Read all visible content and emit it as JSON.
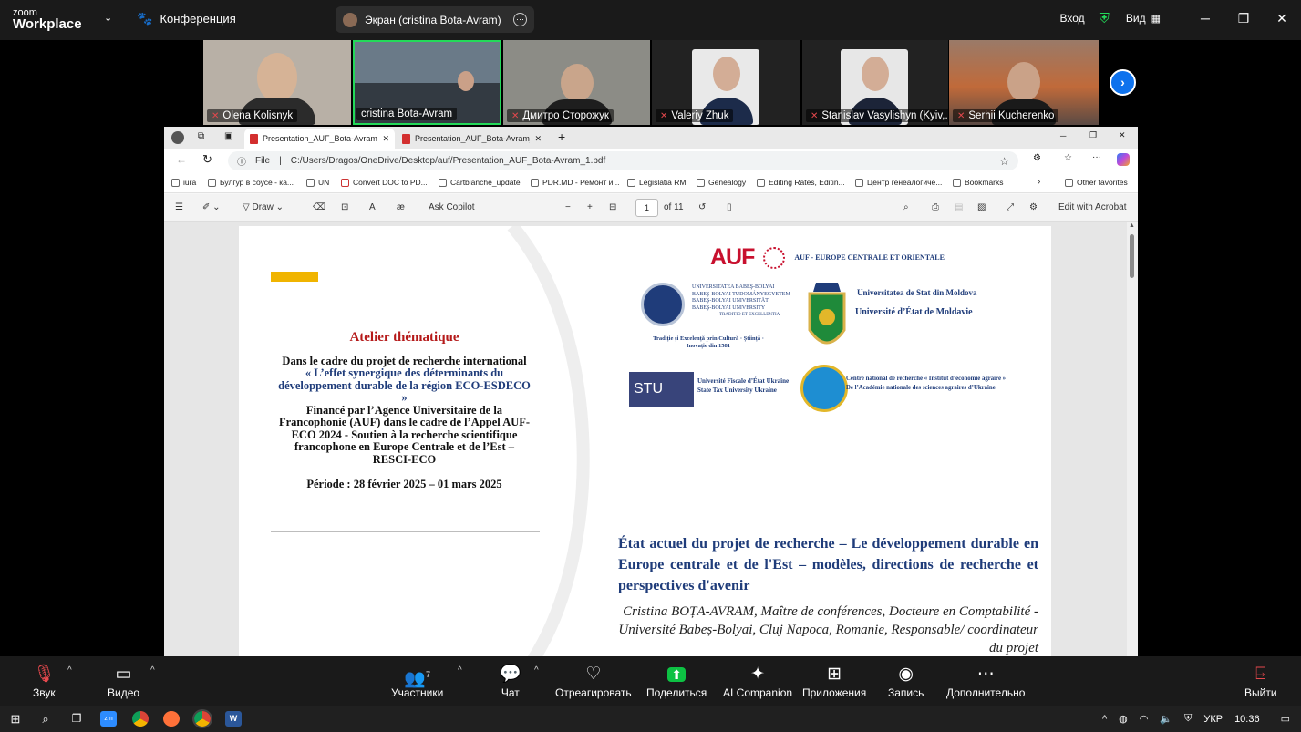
{
  "zoom": {
    "logo_line1": "zoom",
    "logo_line2": "Workplace",
    "conference_label": "Конференция",
    "screen_share_label": "Экран (cristina Bota-Avram)",
    "signin_label": "Вход",
    "view_label": "Вид",
    "participants": [
      {
        "name": "Olena Kolisnyk",
        "muted": true
      },
      {
        "name": "cristina Bota-Avram",
        "muted": false,
        "active": true
      },
      {
        "name": "Дмитро Сторожук",
        "muted": true
      },
      {
        "name": "Valeriy Zhuk",
        "muted": true
      },
      {
        "name": "Stanislav Vasylishyn (Kyiv,...",
        "muted": true
      },
      {
        "name": "Serhii Kucherenko",
        "muted": true
      }
    ],
    "controls": {
      "audio": "Звук",
      "video": "Видео",
      "participants": "Участники",
      "participants_count": "7",
      "chat": "Чат",
      "react": "Отреагировать",
      "share": "Поделиться",
      "companion": "AI Companion",
      "apps": "Приложения",
      "record": "Запись",
      "more": "Дополнительно",
      "leave": "Выйти"
    }
  },
  "browser": {
    "tabs": [
      {
        "title": "Presentation_AUF_Bota-Avram_1..."
      },
      {
        "title": "Presentation_AUF_Bota-Avram_2..."
      }
    ],
    "file_label": "File",
    "url": "C:/Users/Dragos/OneDrive/Desktop/auf/Presentation_AUF_Bota-Avram_1.pdf",
    "bookmarks": [
      "iura",
      "Булгур в соусе - ка...",
      "UN",
      "Convert DOC to PD...",
      "Cartblanche_update",
      "PDR.MD - Ремонт и...",
      "Legislatia RM",
      "Genealogy",
      "Editing Rates, Editin...",
      "Центр генеалогиче...",
      "Bookmarks"
    ],
    "other_favorites": "Other favorites",
    "pdf_toolbar": {
      "draw": "Draw",
      "ask_copilot": "Ask Copilot",
      "page_current": "1",
      "page_total": "of 11",
      "edit_acrobat": "Edit with Acrobat"
    }
  },
  "slide": {
    "atelier": "Atelier thématique",
    "intro": "Dans le cadre du projet de recherche international",
    "project_title": "« L’effet synergique des déterminants du développement durable de la région ECO-ESDECO »",
    "funding": "Financé par l’Agence Universitaire de la Francophonie (AUF) dans le cadre de l’Appel AUF-ECO 2024 - Soutien à la recherche scientifique francophone en Europe Centrale et de l’Est – RESCI-ECO",
    "periode": "Période : 28 février 2025 – 01 mars 2025",
    "auf_word": "AUF",
    "auf_region": "AUF - EUROPE CENTRALE ET ORIENTALE",
    "ubb_names": [
      "UNIVERSITATEA BABEŞ-BOLYAI",
      "BABEŞ-BOLYAI TUDOMÁNYEGYETEM",
      "BABEŞ-BOLYAI UNIVERSITÄT",
      "BABEŞ-BOLYAI UNIVERSITY",
      "TRADITIO ET EXCELLENTIA"
    ],
    "ubb_motto": "Tradiție și Excelență prin Cultură · Știință · Inovație din 1581",
    "usm_ro": "Universitatea de Stat din Moldova",
    "usm_fr": "Université d’État de Moldavie",
    "stu_logo": "STU",
    "stu_fr": "Université Fiscale d’État Ukraine",
    "stu_en": "State Tax University Ukraine",
    "iea_line1": "Centre national de recherche « Institut d’économie agraire »",
    "iea_line2": "De l’Académie nationale des sciences agraires d’Ukraine",
    "title": "État actuel du projet de recherche – Le développement durable en Europe centrale et de l'Est – modèles, directions de recherche et perspectives d'avenir",
    "author": "Cristina BOȚA-AVRAM, Maître de conférences, Docteure en Comptabilité - Université Babeș-Bolyai, Cluj Napoca, Romanie, Responsable/ coordinateur du projet"
  },
  "taskbar": {
    "lang": "УКР",
    "time": "10:36"
  },
  "colors": {
    "zoom_bg": "#1a1a1a",
    "active_speaker": "#23d959",
    "muted_mic": "#e5484d",
    "share_green": "#0dc143",
    "slide_blue": "#1f3c7a",
    "slide_red": "#b51a1a",
    "accent_yellow": "#f0b400"
  }
}
